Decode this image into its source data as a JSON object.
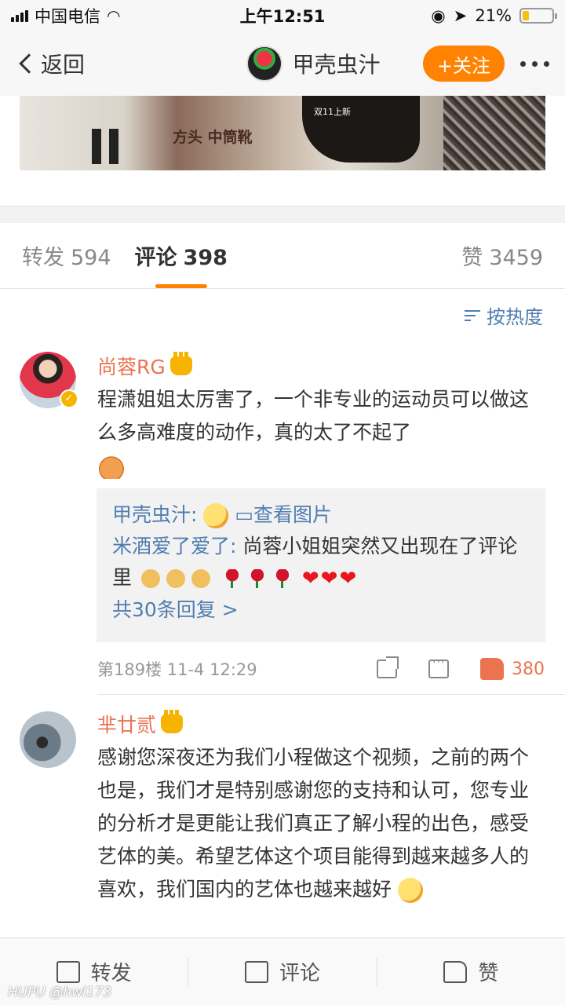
{
  "status_bar": {
    "carrier": "中国电信",
    "time": "上午12:51",
    "battery": "21%",
    "battery_level": 0.21
  },
  "nav": {
    "back_label": "返回",
    "title": "甲壳虫汁",
    "follow_label": "+关注"
  },
  "banner": {
    "text": "方头 中筒靴",
    "sub": "双11上新"
  },
  "tabs": [
    {
      "label": "转发",
      "count": "594"
    },
    {
      "label": "评论",
      "count": "398"
    },
    {
      "label": "赞",
      "count": "3459"
    }
  ],
  "sort_label": "按热度",
  "comments": [
    {
      "name": "尚蓉RG",
      "text": "程潇姐姐太厉害了，一个非专业的运动员可以做这么多高难度的动作，真的太了不起了",
      "replies": [
        {
          "name": "甲壳虫汁:",
          "link": "查看图片"
        },
        {
          "name": "米酒爱了爱了:",
          "text": "尚蓉小姐姐突然又出现在了评论里"
        }
      ],
      "more_replies": "共30条回复 >",
      "floor": "第189楼 11-4 12:29",
      "likes": "380"
    },
    {
      "name": "芈廿贰",
      "text": "感谢您深夜还为我们小程做这个视频，之前的两个也是，我们才是特别感谢您的支持和认可，您专业的分析才是更能让我们真正了解小程的出色，感受艺体的美。希望艺体这个项目能得到越来越多人的喜欢，我们国内的艺体也越来越好"
    }
  ],
  "bottom_bar": {
    "repost": "转发",
    "comment": "评论",
    "like": "赞"
  },
  "watermark": "HUPU @hwl173",
  "colors": {
    "accent": "#ff8200",
    "link": "#507daf",
    "name": "#eb7350"
  }
}
